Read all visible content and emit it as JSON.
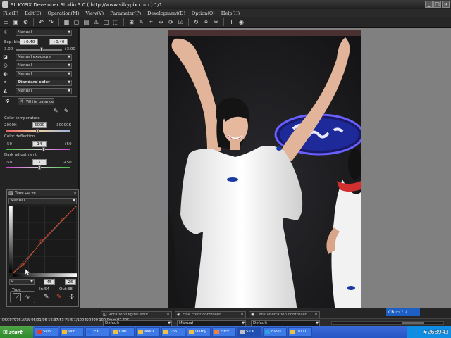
{
  "window": {
    "title": "SILKYPIX Developer Studio 3.0 ( http://www.silkypix.com )    1/1",
    "controls": [
      "_",
      "□",
      "×"
    ]
  },
  "menu": [
    "File(F)",
    "Edit(E)",
    "Operation(M)",
    "View(V)",
    "Parameter(P)",
    "Development(D)",
    "Option(O)",
    "Help(H)"
  ],
  "left_panel": {
    "preset": "Manual",
    "exp_bias_label": "Exp. bias",
    "exp_bias_value": "+0.40",
    "exp_bias_value2": "+0.40",
    "exp_min": "-3.00",
    "exp_max": "+3.00",
    "exposure_mode": "Manual exposure",
    "mode2": "Manual",
    "mode3": "Manual",
    "color_mode": "Standard color",
    "mode5": "Manual",
    "white_balance_label": "White balance",
    "color_temp_label": "Color temperature",
    "color_temp_min": "2000K",
    "color_temp_value": "5000",
    "color_temp_max": "30000K",
    "color_defl_label": "Color deflection",
    "color_defl_min": "-50",
    "color_defl_value": "14",
    "color_defl_max": "+50",
    "dark_adj_label": "Dark adjustment",
    "dark_adj_min": "-50",
    "dark_adj_value": "1",
    "dark_adj_max": "+50"
  },
  "tone_curve": {
    "title": "Tone curve",
    "preset": "Manual",
    "channel": "R",
    "in_value": "45",
    "out_value": "26",
    "type_label": "Type",
    "in_label": "In:54",
    "out_label": "Out:38"
  },
  "bottom_panels": [
    {
      "title": "Rotation/Digital shift",
      "value": "Default"
    },
    {
      "title": "Fine color controller",
      "value": "Manual"
    },
    {
      "title": "Lens aberration controller",
      "value": "Default"
    }
  ],
  "status_text": "DSC07976.ARW 06/01/06 16:37:53 F5.6 1/100 ISO400 100.0mm 97 FPS",
  "zoom_badge": "CB",
  "taskbar": {
    "start_label": "start",
    "tasks": [
      {
        "label": "SON...",
        "color": "#e04030"
      },
      {
        "label": "Win...",
        "color": "#f0c030"
      },
      {
        "label": "EXC...",
        "color": "#3070e0"
      },
      {
        "label": "0001...",
        "color": "#f0c040"
      },
      {
        "label": "aMul...",
        "color": "#f0c040"
      },
      {
        "label": "165...",
        "color": "#f0c040"
      },
      {
        "label": "Darcy",
        "color": "#f0c040"
      },
      {
        "label": "Flick...",
        "color": "#f08040"
      },
      {
        "label": "SILK...",
        "color": "#c0c0c0"
      },
      {
        "label": "qv90...",
        "color": "#30a0e0"
      },
      {
        "label": "0001...",
        "color": "#f0c040"
      }
    ],
    "watermark": "#268943"
  },
  "colors": {
    "accent": "#3d7ae8",
    "panel_bg": "#232323",
    "view_bg": "#808080"
  }
}
